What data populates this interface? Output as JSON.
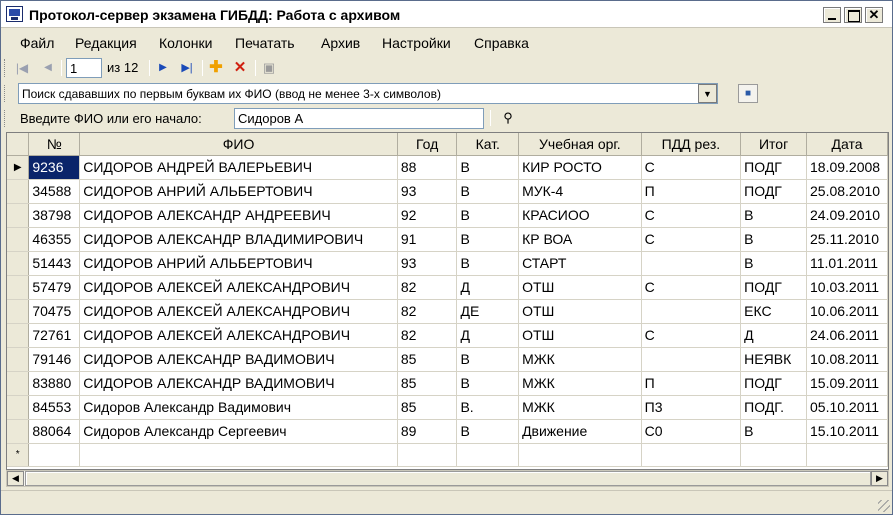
{
  "window": {
    "title": "Протокол-сервер экзамена ГИБДД: Работа с архивом"
  },
  "menu": {
    "items": [
      "Файл",
      "Редакция",
      "Колонки",
      "Печатать",
      "Архив",
      "Настройки",
      "Справка"
    ]
  },
  "navigator": {
    "current_page": "1",
    "page_of": "из 12"
  },
  "search": {
    "mode_text": "Поиск сдававших по первым буквам их ФИО (ввод не менее 3-х символов)",
    "fio_label": "Введите ФИО или его начало:",
    "fio_value": "Сидоров А"
  },
  "table": {
    "columns": [
      "№",
      "ФИО",
      "Год",
      "Кат.",
      "Учебная орг.",
      "ПДД рез.",
      "Итог",
      "Дата"
    ],
    "rows": [
      {
        "num": "9236",
        "fio": "СИДОРОВ АНДРЕЙ ВАЛЕРЬЕВИЧ",
        "year": "88",
        "cat": "В",
        "org": "КИР РОСТО",
        "pdd": "С",
        "result": "ПОДГ",
        "date": "18.09.2008"
      },
      {
        "num": "34588",
        "fio": "СИДОРОВ АНРИЙ АЛЬБЕРТОВИЧ",
        "year": "93",
        "cat": "В",
        "org": "МУК-4",
        "pdd": "П",
        "result": "ПОДГ",
        "date": "25.08.2010"
      },
      {
        "num": "38798",
        "fio": "СИДОРОВ АЛЕКСАНДР АНДРЕЕВИЧ",
        "year": "92",
        "cat": "В",
        "org": "КРАСИОО",
        "pdd": "С",
        "result": "В",
        "date": "24.09.2010"
      },
      {
        "num": "46355",
        "fio": "СИДОРОВ АЛЕКСАНДР ВЛАДИМИРОВИЧ",
        "year": "91",
        "cat": "В",
        "org": "КР ВОА",
        "pdd": "С",
        "result": "В",
        "date": "25.11.2010"
      },
      {
        "num": "51443",
        "fio": "СИДОРОВ АНРИЙ АЛЬБЕРТОВИЧ",
        "year": "93",
        "cat": "В",
        "org": "СТАРТ",
        "pdd": "",
        "result": "В",
        "date": "11.01.2011"
      },
      {
        "num": "57479",
        "fio": "СИДОРОВ АЛЕКСЕЙ АЛЕКСАНДРОВИЧ",
        "year": "82",
        "cat": "Д",
        "org": "ОТШ",
        "pdd": "С",
        "result": "ПОДГ",
        "date": "10.03.2011"
      },
      {
        "num": "70475",
        "fio": "СИДОРОВ АЛЕКСЕЙ АЛЕКСАНДРОВИЧ",
        "year": "82",
        "cat": "ДЕ",
        "org": "ОТШ",
        "pdd": "",
        "result": "ЕКС",
        "date": "10.06.2011"
      },
      {
        "num": "72761",
        "fio": "СИДОРОВ АЛЕКСЕЙ АЛЕКСАНДРОВИЧ",
        "year": "82",
        "cat": "Д",
        "org": "ОТШ",
        "pdd": "С",
        "result": "Д",
        "date": "24.06.2011"
      },
      {
        "num": "79146",
        "fio": "СИДОРОВ АЛЕКСАНДР ВАДИМОВИЧ",
        "year": "85",
        "cat": "В",
        "org": "МЖК",
        "pdd": "",
        "result": "НЕЯВК",
        "date": "10.08.2011"
      },
      {
        "num": "83880",
        "fio": "СИДОРОВ АЛЕКСАНДР ВАДИМОВИЧ",
        "year": "85",
        "cat": "В",
        "org": "МЖК",
        "pdd": "П",
        "result": "ПОДГ",
        "date": "15.09.2011"
      },
      {
        "num": "84553",
        "fio": "Сидоров Александр Вадимович",
        "year": "85",
        "cat": "В.",
        "org": "МЖК",
        "pdd": "П3",
        "result": "ПОДГ.",
        "date": "05.10.2011"
      },
      {
        "num": "88064",
        "fio": "Сидоров Александр Сергеевич",
        "year": "89",
        "cat": "В",
        "org": "Движение",
        "pdd": "С0",
        "result": "В",
        "date": "15.10.2011"
      }
    ],
    "selected_row": 0,
    "new_row_marker": "*",
    "current_row_marker": "▶"
  },
  "icons": {
    "first": "first-page-icon",
    "prev": "prev-page-icon",
    "next": "next-page-icon",
    "last": "last-page-icon",
    "add": "add-icon",
    "delete": "delete-icon",
    "save": "save-icon",
    "find": "binoculars-icon"
  },
  "colors": {
    "selection": "#0a246a",
    "chrome": "#ece9d8",
    "add_icon": "#f0a000",
    "delete_icon": "#d02010",
    "nav_icon": "#1a4ab8"
  }
}
